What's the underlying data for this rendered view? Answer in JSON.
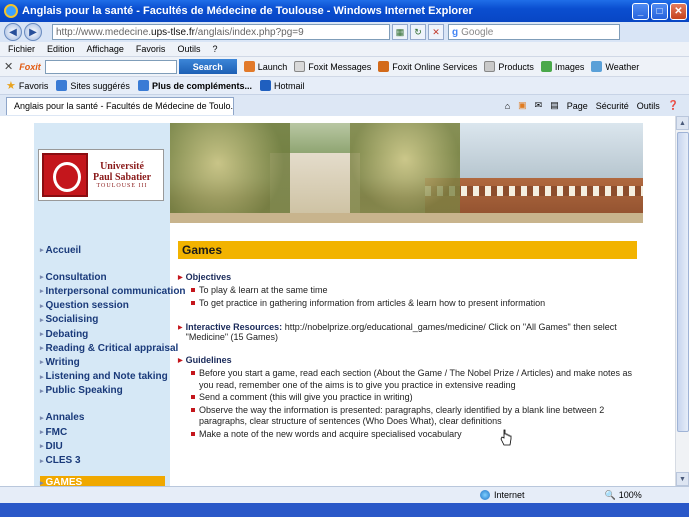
{
  "window": {
    "title": "Anglais pour la santé - Facultés de Médecine de Toulouse - Windows Internet Explorer"
  },
  "address": {
    "url_prefix": "http://www.medecine.",
    "url_domain": "ups-tlse.fr",
    "url_suffix": "/anglais/index.php?pg=9",
    "search_placeholder": "Google"
  },
  "menu": [
    "Fichier",
    "Edition",
    "Affichage",
    "Favoris",
    "Outils",
    "?"
  ],
  "foxit": {
    "logo": "Foxit",
    "search_label": "Search",
    "items": [
      "Launch",
      "Foxit Messages",
      "Foxit Online Services",
      "Products",
      "Images",
      "Weather"
    ]
  },
  "favorites": {
    "label": "Favoris",
    "items": [
      "Sites suggérés",
      "Plus de compléments...",
      "Hotmail"
    ]
  },
  "tab": {
    "title": "Anglais pour la santé - Facultés de Médecine de Toulo..."
  },
  "commands": [
    "Page",
    "Sécurité",
    "Outils"
  ],
  "logo": {
    "line1": "Université",
    "line2": "Paul Sabatier",
    "line3": "TOULOUSE III"
  },
  "nav": {
    "group1": [
      "Accueil"
    ],
    "group2": [
      "Consultation",
      "Interpersonal communication",
      "Question session",
      "Socialising",
      "Debating",
      "Reading & Critical appraisal",
      "Writing",
      "Listening and Note taking",
      "Public Speaking"
    ],
    "group3": [
      "Annales",
      "FMC",
      "DIU",
      "CLES 3"
    ],
    "active": "GAMES"
  },
  "page": {
    "heading": "Games",
    "objectives_title": "Objectives",
    "objectives": [
      "To play & learn at the same time",
      "To get practice in gathering information from articles & learn how to present information"
    ],
    "resources_label": "Interactive Resources:",
    "resources_text": "http://nobelprize.org/educational_games/medicine/ Click on \"All Games\" then select \"Medicine\" (15 Games)",
    "guidelines_title": "Guidelines",
    "guidelines": [
      "Before you start a game, read each section (About the Game / The Nobel Prize / Articles) and make notes as you read, remember one of the aims is to give you practice in extensive reading",
      "Send a comment (this will give you practice in writing)",
      "Observe the way the information is presented: paragraphs, clearly identified by a blank line between 2 paragraphs, clear structure of sentences (Who Does What), clear definitions",
      "Make a note of the new words and acquire specialised vocabulary"
    ]
  },
  "status": {
    "zone": "Internet",
    "zoom": "100%"
  },
  "colors": {
    "accent": "#f2b300",
    "nav_text": "#1a3a7a",
    "sidebar_bg": "#d6e8f6",
    "bullet": "#c4161c"
  }
}
